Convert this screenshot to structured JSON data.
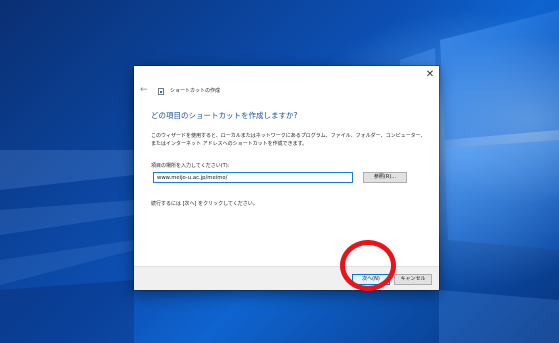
{
  "window": {
    "title": "ショートカットの作成",
    "close_glyph": "✕",
    "back_glyph": "←"
  },
  "main": {
    "heading": "どの項目のショートカットを作成しますか?",
    "description": "このウィザードを使用すると、ローカルまたはネットワークにあるプログラム、ファイル、フォルダー、コンピューター、またはインターネット アドレスへのショートカットを作成できます。",
    "location_label": "項目の場所を入力してください(T):",
    "location_value": "www.meijo-u.ac.jp/meimo/",
    "browse_label": "参照(R)...",
    "hint": "続行するには [次へ] をクリックしてください。"
  },
  "footer": {
    "next_label": "次へ(N)",
    "cancel_label": "キャンセル"
  },
  "colors": {
    "heading": "#1a4fa3",
    "highlight": "#e8141a",
    "accent_border": "#0078d7"
  },
  "icons": [
    "close-icon",
    "back-arrow-icon",
    "shortcut-icon"
  ]
}
